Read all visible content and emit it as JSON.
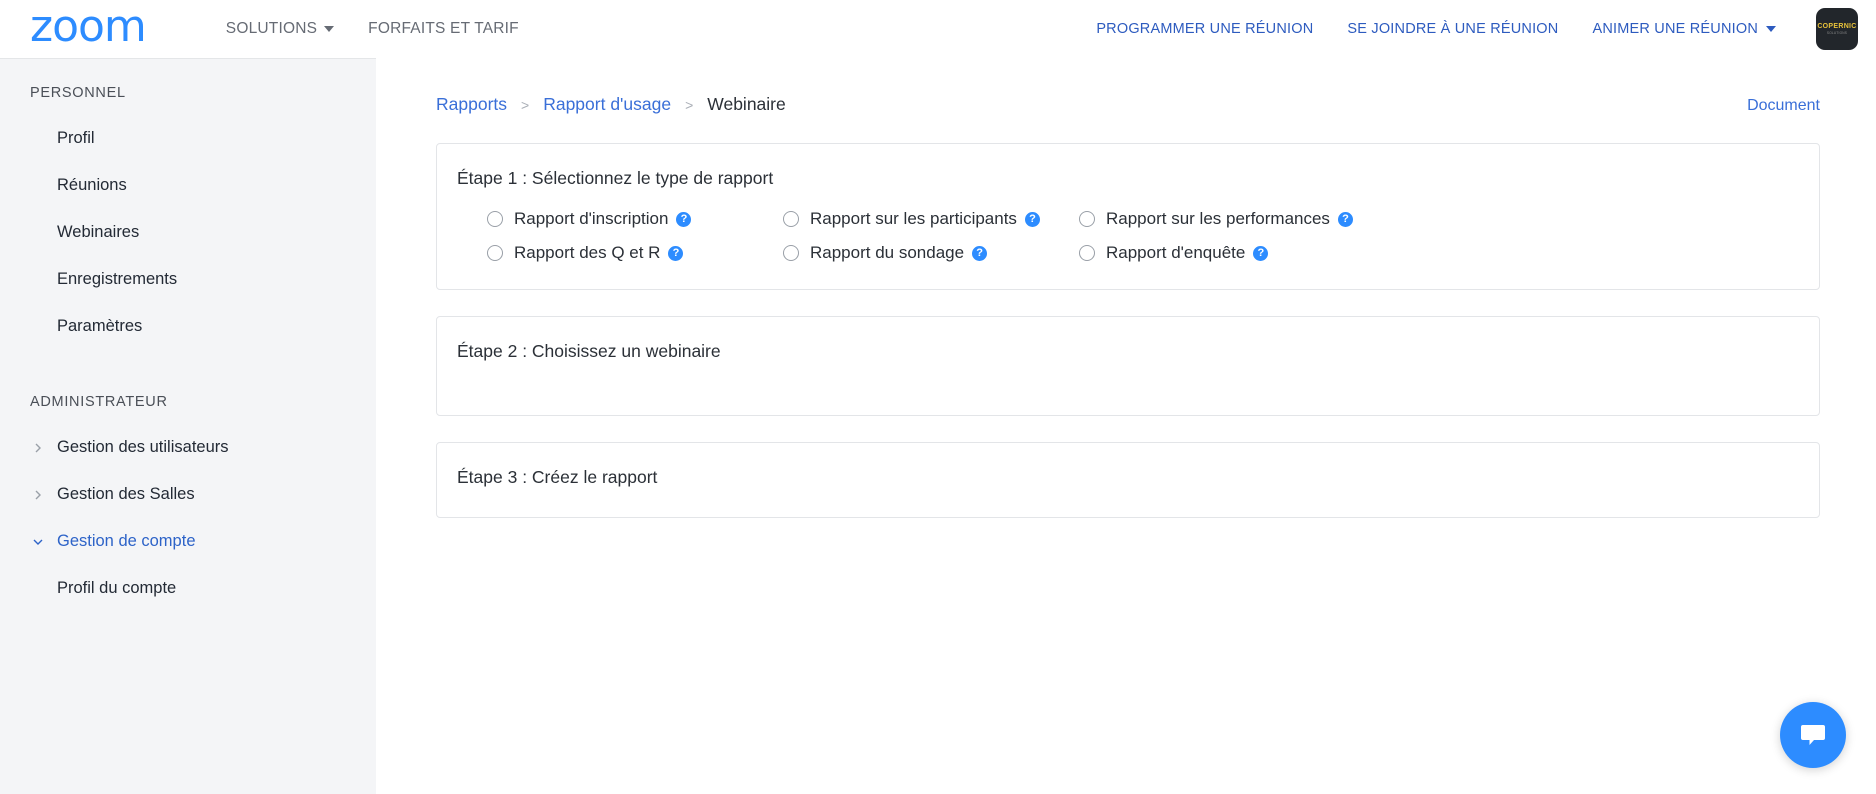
{
  "header": {
    "logo_text": "zoom",
    "nav_left": [
      {
        "label": "SOLUTIONS",
        "has_caret": true
      },
      {
        "label": "FORFAITS ET TARIF",
        "has_caret": false
      }
    ],
    "nav_right": [
      {
        "label": "PROGRAMMER UNE RÉUNION",
        "has_caret": false
      },
      {
        "label": "SE JOINDRE À UNE RÉUNION",
        "has_caret": false
      },
      {
        "label": "ANIMER UNE RÉUNION",
        "has_caret": true
      }
    ],
    "avatar": {
      "brand": "COPERNIC",
      "subtitle": "SOLUTIONS"
    },
    "accent_blue": "#2d8cff",
    "link_blue": "#2d5bbf"
  },
  "sidebar": {
    "sections": [
      {
        "title": "PERSONNEL",
        "items": [
          {
            "label": "Profil",
            "expandable": false,
            "active": false
          },
          {
            "label": "Réunions",
            "expandable": false,
            "active": false
          },
          {
            "label": "Webinaires",
            "expandable": false,
            "active": false
          },
          {
            "label": "Enregistrements",
            "expandable": false,
            "active": false
          },
          {
            "label": "Paramètres",
            "expandable": false,
            "active": false
          }
        ]
      },
      {
        "title": "ADMINISTRATEUR",
        "items": [
          {
            "label": "Gestion des utilisateurs",
            "expandable": true,
            "expanded": false,
            "active": false
          },
          {
            "label": "Gestion des Salles",
            "expandable": true,
            "expanded": false,
            "active": false
          },
          {
            "label": "Gestion de compte",
            "expandable": true,
            "expanded": true,
            "active": true
          },
          {
            "label": "Profil du compte",
            "expandable": false,
            "active": false,
            "sub": true
          }
        ]
      }
    ]
  },
  "breadcrumb": {
    "items": [
      {
        "label": "Rapports",
        "current": false
      },
      {
        "label": "Rapport d'usage",
        "current": false
      },
      {
        "label": "Webinaire",
        "current": true
      }
    ],
    "separator": ">"
  },
  "document_link": "Document",
  "steps": [
    {
      "title": "Étape 1 : Sélectionnez le type de rapport",
      "options_rows": [
        [
          {
            "label": "Rapport d'inscription",
            "selected": false,
            "help": "?"
          },
          {
            "label": "Rapport sur les participants",
            "selected": false,
            "help": "?"
          },
          {
            "label": "Rapport sur les performances",
            "selected": false,
            "help": "?"
          }
        ],
        [
          {
            "label": "Rapport des Q et R",
            "selected": false,
            "help": "?"
          },
          {
            "label": "Rapport du sondage",
            "selected": false,
            "help": "?"
          },
          {
            "label": "Rapport d'enquête",
            "selected": false,
            "help": "?"
          }
        ]
      ]
    },
    {
      "title": "Étape 2 : Choisissez un webinaire",
      "options_rows": []
    },
    {
      "title": "Étape 3 : Créez le rapport",
      "options_rows": []
    }
  ],
  "chat_button": {
    "icon": "chat-bubble-icon"
  }
}
